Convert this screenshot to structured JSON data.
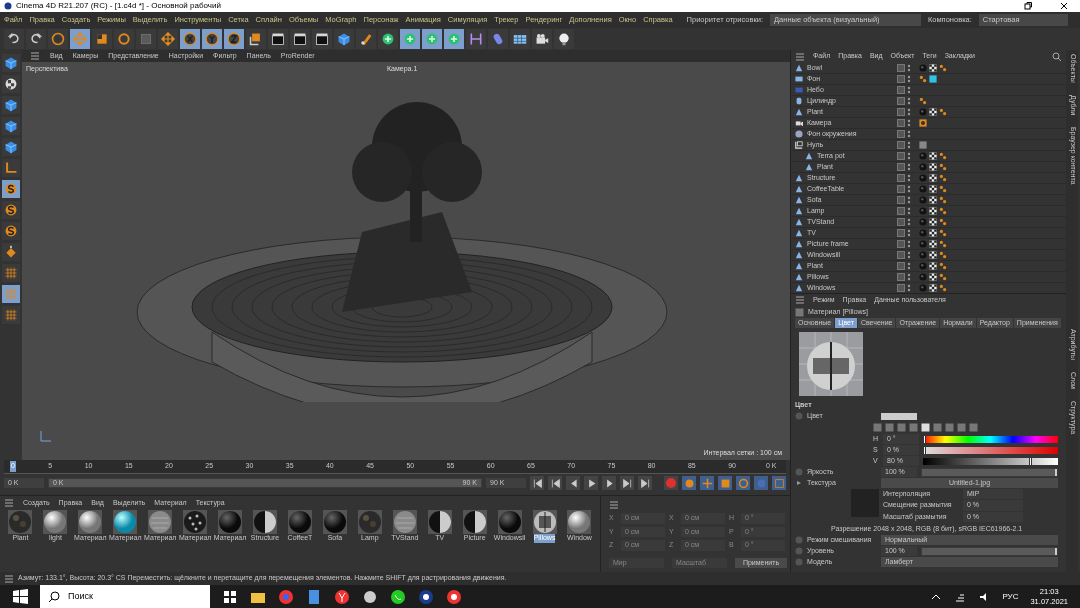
{
  "window": {
    "title": "Cinema 4D R21.207 (RC) - [1.c4d *] - Основной рабочий"
  },
  "menu": [
    "Файл",
    "Правка",
    "Создать",
    "Режимы",
    "Выделить",
    "Инструменты",
    "Сетка",
    "Сплайн",
    "Объемы",
    "MoGraph",
    "Персонаж",
    "Анимация",
    "Симуляция",
    "Трекер",
    "Рендеринг",
    "Дополнения",
    "Окно",
    "Справка"
  ],
  "priority": {
    "label": "Приоритет отрисовки:",
    "value": "Данные объекта (визуальный)"
  },
  "layout": {
    "label": "Компоновка:",
    "value": "Стартовая"
  },
  "tools": [
    {
      "kind": "undo",
      "selected": false
    },
    {
      "kind": "redo",
      "selected": false
    },
    {
      "kind": "select",
      "selected": false
    },
    {
      "kind": "move",
      "selected": true
    },
    {
      "kind": "scale",
      "selected": false
    },
    {
      "kind": "rotate",
      "selected": false
    },
    {
      "kind": "blank",
      "selected": false
    },
    {
      "kind": "move",
      "selected": false
    },
    {
      "kind": "x",
      "selected": true
    },
    {
      "kind": "y",
      "selected": true
    },
    {
      "kind": "z",
      "selected": true
    },
    {
      "kind": "coord",
      "selected": false
    },
    {
      "kind": "clap",
      "selected": false
    },
    {
      "kind": "clap",
      "selected": false
    },
    {
      "kind": "clap",
      "selected": false
    },
    {
      "kind": "cube",
      "selected": false
    },
    {
      "kind": "pen",
      "selected": false
    },
    {
      "kind": "green",
      "selected": false
    },
    {
      "kind": "green",
      "selected": true
    },
    {
      "kind": "green",
      "selected": true
    },
    {
      "kind": "green",
      "selected": true
    },
    {
      "kind": "bend",
      "selected": false
    },
    {
      "kind": "capsule",
      "selected": false
    },
    {
      "kind": "floor",
      "selected": false
    },
    {
      "kind": "camera",
      "selected": false
    },
    {
      "kind": "light",
      "selected": false
    }
  ],
  "left_tools": [
    {
      "kind": "cube",
      "selected": false
    },
    {
      "kind": "texture",
      "selected": false
    },
    {
      "kind": "cube",
      "selected": false
    },
    {
      "kind": "cube",
      "selected": false
    },
    {
      "kind": "cube",
      "selected": false
    },
    {
      "kind": "axis",
      "selected": false
    },
    {
      "kind": "snap",
      "selected": true
    },
    {
      "kind": "snap",
      "selected": false
    },
    {
      "kind": "snap",
      "selected": false
    },
    {
      "kind": "paint",
      "selected": false
    },
    {
      "kind": "grid",
      "selected": false
    },
    {
      "kind": "grid",
      "selected": true
    },
    {
      "kind": "grid",
      "selected": false
    }
  ],
  "viewport": {
    "menu": [
      "Вид",
      "Камеры",
      "Представление",
      "Настройки",
      "Фильтр",
      "Панель",
      "ProRender"
    ],
    "view_name": "Перспектива",
    "camera": "Камера.1",
    "grid_info": "Интервал сетки : 100 см"
  },
  "timeline": {
    "ticks": [
      "0",
      "5",
      "10",
      "15",
      "20",
      "25",
      "30",
      "35",
      "40",
      "45",
      "50",
      "55",
      "60",
      "65",
      "70",
      "75",
      "80",
      "85",
      "90"
    ],
    "end_label": "0 K",
    "start": "0 K",
    "range": {
      "start": "0 K",
      "end": "90 K",
      "level": 1
    },
    "end": "90 K"
  },
  "materials": {
    "menu": [
      "Создать",
      "Правка",
      "Вид",
      "Выделить",
      "Материал",
      "Текстура"
    ],
    "items": [
      {
        "name": "Plant",
        "kind": "dark",
        "selected": false
      },
      {
        "name": "light",
        "kind": "white",
        "selected": false
      },
      {
        "name": "Материал",
        "kind": "white",
        "selected": false
      },
      {
        "name": "Материал",
        "kind": "cyan",
        "selected": false
      },
      {
        "name": "Материал",
        "kind": "noise",
        "selected": false
      },
      {
        "name": "Материал",
        "kind": "dots",
        "selected": false
      },
      {
        "name": "Материал",
        "kind": "black",
        "selected": false
      },
      {
        "name": "Structure",
        "kind": "half",
        "selected": false
      },
      {
        "name": "CoffeeT",
        "kind": "black",
        "selected": false
      },
      {
        "name": "Sofa",
        "kind": "black",
        "selected": false
      },
      {
        "name": "Lamp",
        "kind": "dark",
        "selected": false
      },
      {
        "name": "TVStand",
        "kind": "noise",
        "selected": false
      },
      {
        "name": "TV",
        "kind": "half",
        "selected": false
      },
      {
        "name": "Picture",
        "kind": "half",
        "selected": false
      },
      {
        "name": "Windowsil",
        "kind": "black",
        "selected": false
      },
      {
        "name": "Pillows",
        "kind": "pillow",
        "selected": true
      },
      {
        "name": "Window",
        "kind": "white",
        "selected": false
      }
    ]
  },
  "coords": {
    "rows": [
      [
        "X",
        "0 см",
        "X",
        "0 см",
        "H",
        "0 °"
      ],
      [
        "Y",
        "0 см",
        "Y",
        "0 см",
        "P",
        "0 °"
      ],
      [
        "Z",
        "0 см",
        "Z",
        "0 см",
        "B",
        "0 °"
      ]
    ],
    "mode": "Мир",
    "size_mode": "Масштаб",
    "apply": "Применить"
  },
  "objects": {
    "menu": [
      "Файл",
      "Правка",
      "Вид",
      "Объект",
      "Теги",
      "Закладки"
    ],
    "items": [
      {
        "name": "Bowl",
        "kind": "poly"
      },
      {
        "name": "Фон",
        "kind": "bg"
      },
      {
        "name": "Небо",
        "kind": "sky"
      },
      {
        "name": "Цилиндр",
        "kind": "cyl"
      },
      {
        "name": "Plant",
        "kind": "poly"
      },
      {
        "name": "Камера",
        "kind": "cam"
      },
      {
        "name": "Фон окружения",
        "kind": "env"
      },
      {
        "name": "Нуль",
        "kind": "null",
        "children": [
          {
            "name": "Terra pot",
            "kind": "poly"
          },
          {
            "name": "Plant",
            "kind": "poly"
          }
        ]
      },
      {
        "name": "Structure",
        "kind": "poly"
      },
      {
        "name": "CoffeeTable",
        "kind": "poly"
      },
      {
        "name": "Sofa",
        "kind": "poly"
      },
      {
        "name": "Lamp",
        "kind": "poly"
      },
      {
        "name": "TVStand",
        "kind": "poly"
      },
      {
        "name": "TV",
        "kind": "poly"
      },
      {
        "name": "Picture frame",
        "kind": "poly"
      },
      {
        "name": "Windowsill",
        "kind": "poly"
      },
      {
        "name": "Plant",
        "kind": "poly"
      },
      {
        "name": "Pillows",
        "kind": "poly"
      },
      {
        "name": "Windows",
        "kind": "poly"
      }
    ]
  },
  "attributes": {
    "menu": [
      "Режим",
      "Правка",
      "Данные пользователя"
    ],
    "title": "Материал [Pillows]",
    "tabs": [
      {
        "label": "Основные",
        "selected": false
      },
      {
        "label": "Цвет",
        "selected": true
      },
      {
        "label": "Свечение",
        "selected": false
      },
      {
        "label": "Отражение",
        "selected": false
      },
      {
        "label": "Нормали",
        "selected": false
      },
      {
        "label": "Редактор",
        "selected": false
      },
      {
        "label": "Применения",
        "selected": false
      }
    ],
    "section": "Цвет",
    "color_label": "Цвет",
    "hsv": [
      {
        "label": "H",
        "value": "0 °",
        "kind": "hue",
        "level": 0
      },
      {
        "label": "S",
        "value": "0 %",
        "kind": "sat",
        "level": 0
      },
      {
        "label": "V",
        "value": "80 %",
        "kind": "val",
        "level": 0.8
      }
    ],
    "brightness": {
      "label": "Яркость",
      "value": "100 %",
      "level": 1
    },
    "texture": {
      "label": "Текстура",
      "file": "Untitled-1.jpg",
      "rows": [
        {
          "label": "Интерполяция",
          "value": "MIP"
        },
        {
          "label": "Смещение размытия",
          "value": "0 %"
        },
        {
          "label": "Масштаб размытия",
          "value": "0 %"
        }
      ],
      "resolution": "Разрешение 2048 x 2048, RGB (8 бит), sRGB IEC61966-2.1"
    },
    "mix_mode": {
      "label": "Режим смешивания",
      "value": "Нормальный"
    },
    "mix_level": {
      "label": "Уровень",
      "value": "100 %",
      "level": 1
    },
    "model": {
      "label": "Модель",
      "value": "Ламберт"
    }
  },
  "side_tabs": {
    "top": [
      "Объекты",
      "Дубли",
      "Браузер контента"
    ],
    "bottom": [
      "Атрибуты",
      "Слои",
      "Структура"
    ]
  },
  "status_bar": "Азимут: 133.1°, Высота: 20.3° CS     Переместить: щёлкните и перетащите для перемещения элементов. Нажмите SHIFT для растрирования движения.",
  "taskbar": {
    "search": "Поиск",
    "lang": "РУС",
    "time": "21:03",
    "date": "31.07.2021"
  }
}
